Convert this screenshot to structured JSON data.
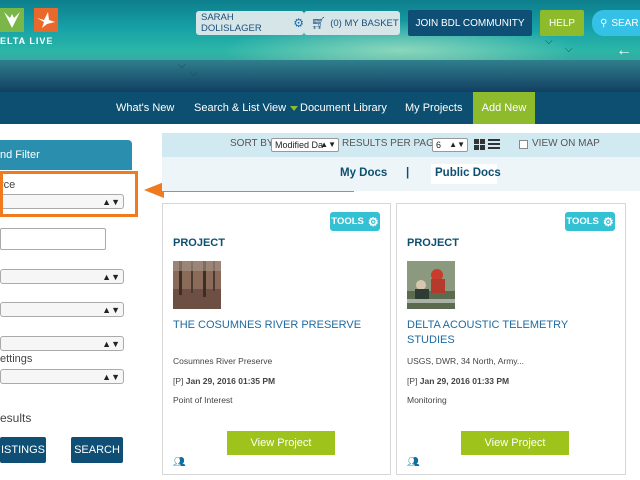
{
  "header": {
    "logo_text": "ELTA LIVE",
    "user_name": "SARAH DOLISLAGER",
    "basket_label": "(0) MY BASKET",
    "join_label": "JOIN BDL COMMUNITY",
    "help_label": "HELP",
    "search_label": "SEAR"
  },
  "nav": {
    "items": [
      "What's New",
      "Search & List View",
      "Document Library",
      "My Projects"
    ],
    "add_new": "Add New"
  },
  "sidebar": {
    "header": "nd Filter",
    "source_label": "rce",
    "settings_label": "ettings",
    "results_label": "esults",
    "listings_btn": "ISTINGS",
    "search_btn": "SEARCH"
  },
  "sortbar": {
    "sort_by": "SORT BY",
    "sort_value": "Modified Da",
    "results_per_page": "RESULTS PER PAGE",
    "rpp_value": "6",
    "view_on_map": "VIEW ON MAP"
  },
  "tabs": {
    "my_docs": "My Docs",
    "separator": "|",
    "public_docs": "Public Docs"
  },
  "cards": [
    {
      "tools": "TOOLS",
      "type": "PROJECT",
      "title": "THE COSUMNES RIVER PRESERVE",
      "subtitle": "Cosumnes River Preserve",
      "date_prefix": "[P]",
      "date": "Jan 29, 2016 01:35 PM",
      "category": "Point of Interest",
      "view_btn": "View Project"
    },
    {
      "tools": "TOOLS",
      "type": "PROJECT",
      "title": "DELTA ACOUSTIC TELEMETRY STUDIES",
      "subtitle": "USGS, DWR, 34 North, Army...",
      "date_prefix": "[P]",
      "date": "Jan 29, 2016 01:33 PM",
      "category": "Monitoring",
      "view_btn": "View Project"
    }
  ],
  "colors": {
    "nav_bg": "#0c4f70",
    "accent_green": "#8dbb2c",
    "accent_cyan": "#35c1d4",
    "annotation_orange": "#f07a1e"
  }
}
